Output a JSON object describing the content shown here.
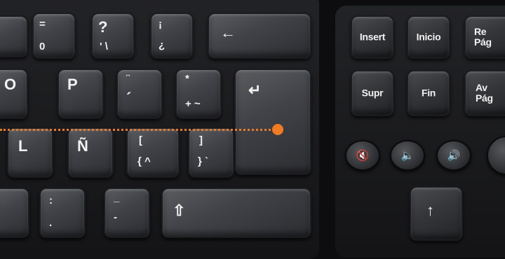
{
  "keys": {
    "o": "O",
    "p": "P",
    "l": "L",
    "enye": "Ñ",
    "equals_top": "=",
    "equals_bottom": "0",
    "question_top": "?",
    "question_bottom": "' \\",
    "exclaim_top": "¡",
    "exclaim_bottom": "¿",
    "diaeresis": "¨",
    "acute": "´",
    "star_top": "*",
    "star_bottom": "+ ~",
    "lbracket_top": "[",
    "lbracket_bottom": "{ ^",
    "rbracket_top": "]",
    "rbracket_bottom": "} `",
    "colon_top": ":",
    "colon_bottom": ".",
    "underscore_top": "_",
    "underscore_bottom": "-",
    "backspace": "←",
    "enter": "↵",
    "shift": "⇧",
    "up": "↑",
    "insert": "Insert",
    "inicio": "Inicio",
    "repag": "Re\nPág",
    "supr": "Supr",
    "fin": "Fin",
    "avpag": "Av\nPág"
  },
  "media_buttons": [
    "mute-icon",
    "volume-down-icon",
    "volume-up-icon"
  ],
  "colors": {
    "annotation": "#f07b22"
  }
}
